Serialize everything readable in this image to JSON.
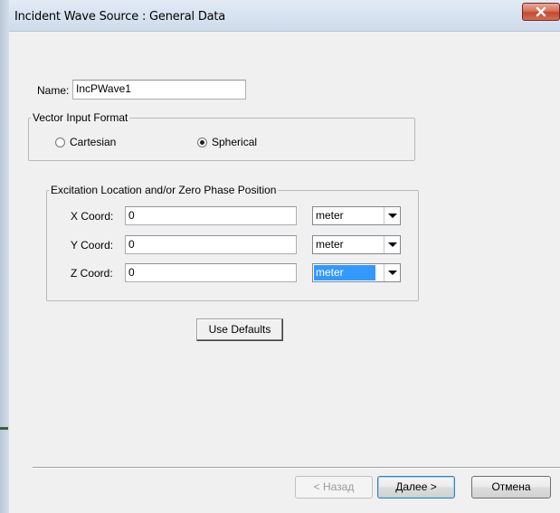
{
  "window": {
    "title": "Incident Wave Source : General Data",
    "close_icon": "close-icon"
  },
  "name_field": {
    "label": "Name:",
    "value": "IncPWave1"
  },
  "vector_input_format": {
    "title": "Vector Input Format",
    "options": [
      {
        "label": "Cartesian",
        "selected": false
      },
      {
        "label": "Spherical",
        "selected": true
      }
    ]
  },
  "excitation": {
    "title": "Excitation Location and/or Zero Phase Position",
    "rows": [
      {
        "label": "X Coord:",
        "value": "0",
        "unit": "meter",
        "unit_selected": false
      },
      {
        "label": "Y Coord:",
        "value": "0",
        "unit": "meter",
        "unit_selected": false
      },
      {
        "label": "Z Coord:",
        "value": "0",
        "unit": "meter",
        "unit_selected": true
      }
    ]
  },
  "use_defaults_label": "Use Defaults",
  "footer": {
    "back_label": "< Назад",
    "next_label": "Далее >",
    "cancel_label": "Отмена"
  },
  "colors": {
    "selection": "#3399ff",
    "close_button": "#c24a30"
  }
}
